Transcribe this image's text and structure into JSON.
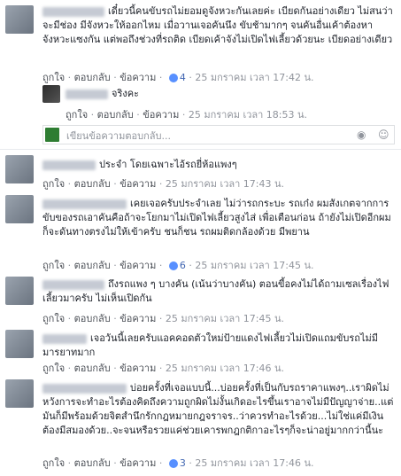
{
  "actions": {
    "like": "ถูกใจ",
    "reply": "ตอบกลับ",
    "translate": "ข้อความ",
    "dot": "·"
  },
  "comments": [
    {
      "text": "เดี๋ยวนี้คนขับรถไม่ยอมดูจังหวะกันเลยค่ะ เบียดกันอย่างเดียว ไม่สนว่าจะมีช่อง มีจังหวะให้ออกไหม เมื่อวานเจอคันนึง ขับช้ามากๆ จนคันอื่นเค้าต้องหาจังหวะแซงกัน แต่พอถึงช่วงที่รถติด เบียดเค้าจังไม่เปิดไฟเลี้ยวด้วยนะ เบียดอย่างเดียว",
      "likes": "4",
      "time": "25 มกราคม เวลา 17:42 น."
    },
    {
      "text": "จริงคะ",
      "likes": "",
      "time": "25 มกราคม เวลา 18:53 น."
    },
    {
      "text": "ประจำ โดยเฉพาะไอ้รถยี่ห้อแพงๆ",
      "likes": "",
      "time": "25 มกราคม เวลา 17:43 น."
    },
    {
      "text": "เคยเจอครับประจำเลย ไม่ว่ารถกระบะ รถเก๋ง ผมสังเกตจากการขับของรถเอาคันคือถ้าจะโยกมาไม่เปิดไฟเลี้ยวสูงไส่ เพื่อเตือนก่อน ถ้ายังไม่เปิดอีกผมก็จะดันทางตรงไม่ให้เข้าครับ ชนก็ชน รถผมติดกล้องด้วย มีพยาน",
      "likes": "6",
      "time": "25 มกราคม เวลา 17:45 น."
    },
    {
      "text": "ถึงรถแพง ๆ บางคัน (เน้นว่าบางคัน) ตอนขี้อคงไม่ได้ถามเซลเรื่องไฟเลี้ยวมาครับ ไม่เห็นเปิดกัน",
      "likes": "",
      "time": "25 มกราคม เวลา 17:45 น."
    },
    {
      "text": "เจอวันนี้เลยครับแอคคอดตัวใหม่ป้ายแดงไฟเลี้ยวไม่เปิดแถมขับรถไม่มีมารยาทมาก",
      "likes": "",
      "time": "25 มกราคม เวลา 17:46 น."
    },
    {
      "text": "บ่อยครั้งที่เจอแบบนี้...บ่อยครั้งที่เป็นกับรถราคาแพงๆ..เราผิดไม่หวังการจะทำอะไรต้องคิดถึงความถูกผิดไม่งั้นเกิดอะไรขึ้นเราอาจไม่มีปัญญาจ่าย..แต่มันก็มีพร้อมด้วยจิตสำนึกรักกฎหมายกฎจราจร..ว่าควรทำอะไรด้วย...ไม่ใช่แค่มีเงินต้องมีสมองด้วย..จะจนหรือรวยแค่ช่วยเคารพกฎกติกาอะไรๆก็จะน่าอยู่มากกว่านี้นะ",
      "likes": "3",
      "time": "25 มกราคม เวลา 17:46 น."
    }
  ],
  "reply_box": {
    "placeholder": "เขียนข้อความตอบกลับ..."
  },
  "icons": {
    "camera": "camera-icon",
    "emoji": "emoji-icon",
    "like": "like-thumb-icon"
  }
}
